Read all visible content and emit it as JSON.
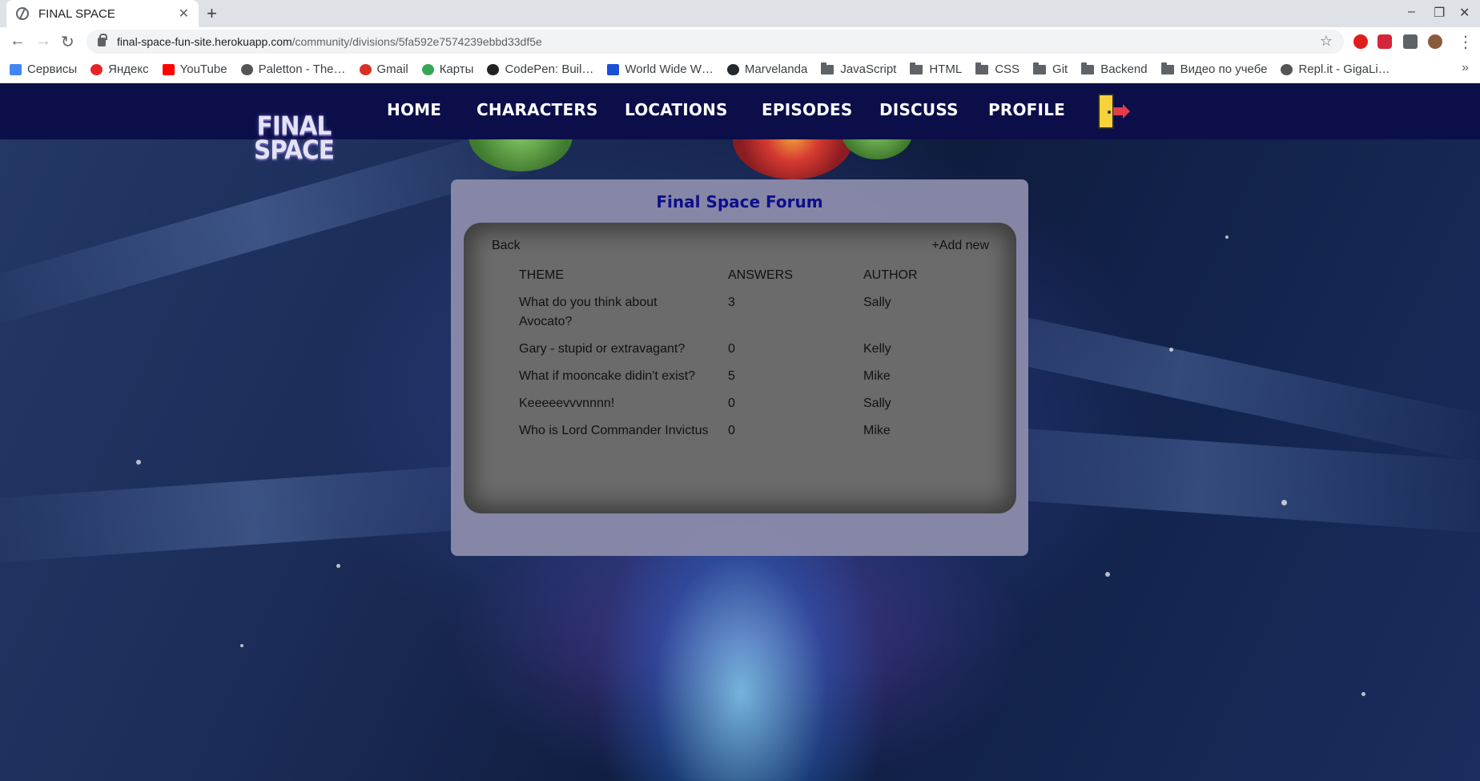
{
  "browser": {
    "tab_title": "FINAL SPACE",
    "url_host": "final-space-fun-site.herokuapp.com",
    "url_path": "/community/divisions/5fa592e7574239ebbd33df5e",
    "bookmarks": [
      {
        "label": "Сервисы",
        "icon": "apps-grid-icon",
        "color": "#4285f4"
      },
      {
        "label": "Яндекс",
        "icon": "yandex-icon",
        "color": "#e6252b"
      },
      {
        "label": "YouTube",
        "icon": "youtube-icon",
        "color": "#ff0000"
      },
      {
        "label": "Paletton - The…",
        "icon": "paletton-icon",
        "color": "#555555"
      },
      {
        "label": "Gmail",
        "icon": "gmail-icon",
        "color": "#d93025"
      },
      {
        "label": "Карты",
        "icon": "maps-icon",
        "color": "#34a853"
      },
      {
        "label": "CodePen: Buil…",
        "icon": "codepen-icon",
        "color": "#222222"
      },
      {
        "label": "World Wide W…",
        "icon": "w3schools-icon",
        "color": "#1a4fd6"
      },
      {
        "label": "Marvelanda",
        "icon": "github-icon",
        "color": "#24292e"
      },
      {
        "label": "JavaScript",
        "icon": "folder-icon",
        "color": "#5f6368"
      },
      {
        "label": "HTML",
        "icon": "folder-icon",
        "color": "#5f6368"
      },
      {
        "label": "CSS",
        "icon": "folder-icon",
        "color": "#5f6368"
      },
      {
        "label": "Git",
        "icon": "folder-icon",
        "color": "#5f6368"
      },
      {
        "label": "Backend",
        "icon": "folder-icon",
        "color": "#5f6368"
      },
      {
        "label": "Видео по учебе",
        "icon": "folder-icon",
        "color": "#5f6368"
      },
      {
        "label": "Repl.it - GigaLi…",
        "icon": "replit-icon",
        "color": "#555555"
      }
    ]
  },
  "site": {
    "logo_line1": "FINAL",
    "logo_line2": "SPACE",
    "nav": [
      "HOME",
      "CHARACTERS",
      "LOCATIONS",
      "EPISODES",
      "DISCUSS",
      "PROFILE"
    ]
  },
  "forum": {
    "title": "Final Space Forum",
    "back_label": "Back",
    "add_label": "+Add new",
    "columns": [
      "THEME",
      "ANSWERS",
      "AUTHOR"
    ],
    "topics": [
      {
        "theme": "What do you think about Avocato?",
        "answers": "3",
        "author": "Sally"
      },
      {
        "theme": "Gary - stupid or extravagant?",
        "answers": "0",
        "author": "Kelly"
      },
      {
        "theme": "What if mooncake didin't exist?",
        "answers": "5",
        "author": "Mike"
      },
      {
        "theme": "Keeeeevvvnnnn!",
        "answers": "0",
        "author": "Sally"
      },
      {
        "theme": "Who is Lord Commander Invictus",
        "answers": "0",
        "author": "Mike"
      }
    ]
  },
  "colors": {
    "nav_bg": "#0c0e4a",
    "forum_title": "#0d0f8a",
    "panel_bg": "#8a8aaa",
    "inner_bg": "#6b6b6b"
  }
}
